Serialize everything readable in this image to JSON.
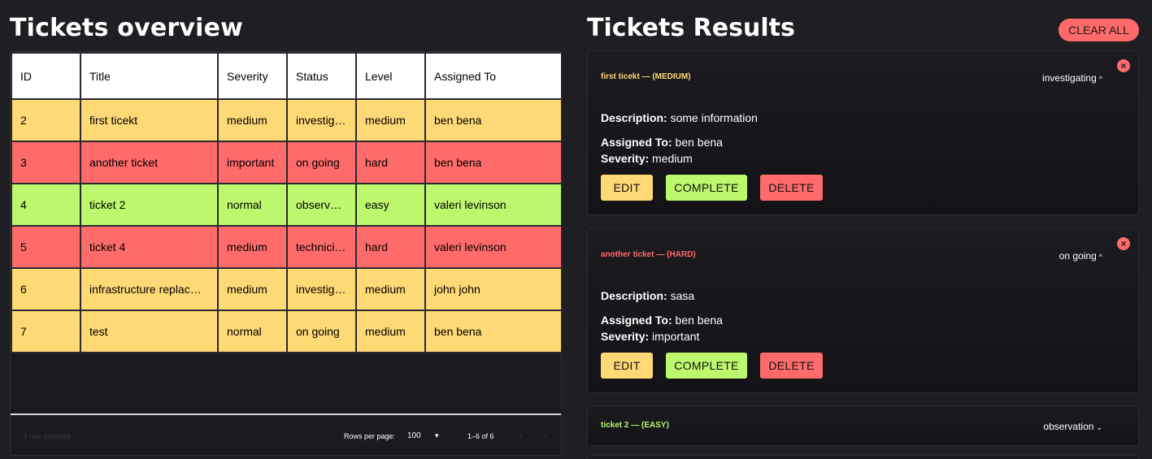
{
  "overview": {
    "title": "Tickets overview",
    "columns": [
      "ID",
      "Title",
      "Severity",
      "Status",
      "Level",
      "Assigned To"
    ],
    "rows": [
      {
        "id": "2",
        "title": "first ticekt",
        "severity": "medium",
        "status": "investig…",
        "level": "medium",
        "assigned": "ben bena",
        "color": "#fed976"
      },
      {
        "id": "3",
        "title": "another ticket",
        "severity": "important",
        "status": "on going",
        "level": "hard",
        "assigned": "ben bena",
        "color": "#ff6b6b"
      },
      {
        "id": "4",
        "title": "ticket 2",
        "severity": "normal",
        "status": "observ…",
        "level": "easy",
        "assigned": "valeri levinson",
        "color": "#bdf76d"
      },
      {
        "id": "5",
        "title": "ticket 4",
        "severity": "medium",
        "status": "technici…",
        "level": "hard",
        "assigned": "valeri levinson",
        "color": "#ff6b6b"
      },
      {
        "id": "6",
        "title": "infrastructure replac…",
        "severity": "medium",
        "status": "investig…",
        "level": "medium",
        "assigned": "john john",
        "color": "#fed976"
      },
      {
        "id": "7",
        "title": "test",
        "severity": "normal",
        "status": "on going",
        "level": "medium",
        "assigned": "ben bena",
        "color": "#fed976"
      }
    ],
    "footer": {
      "selected": "1 row selected",
      "rows_per_page_label": "Rows per page:",
      "rows_per_page_value": "100",
      "range": "1–6 of 6"
    }
  },
  "results": {
    "title": "Tickets Results",
    "clear_all": "CLEAR ALL",
    "cards": [
      {
        "title": "first ticekt — (MEDIUM)",
        "title_color": "#fed976",
        "status": "investigating",
        "expanded": true,
        "description_label": "Description:",
        "description": "some information",
        "assigned_label": "Assigned To:",
        "assigned": "ben bena",
        "severity_label": "Severity:",
        "severity": "medium"
      },
      {
        "title": "another ticket — (HARD)",
        "title_color": "#ff6b6b",
        "status": "on going",
        "expanded": true,
        "description_label": "Description:",
        "description": "sasa",
        "assigned_label": "Assigned To:",
        "assigned": "ben bena",
        "severity_label": "Severity:",
        "severity": "important"
      },
      {
        "title": "ticket 2 — (EASY)",
        "title_color": "#bdf76d",
        "status": "observation",
        "expanded": false
      }
    ],
    "buttons": {
      "edit": "EDIT",
      "complete": "COMPLETE",
      "delete": "DELETE"
    }
  },
  "icons": {
    "close": "close-circle-icon",
    "chevron_up": "chevron-up-icon",
    "chevron_down": "chevron-down-icon"
  }
}
